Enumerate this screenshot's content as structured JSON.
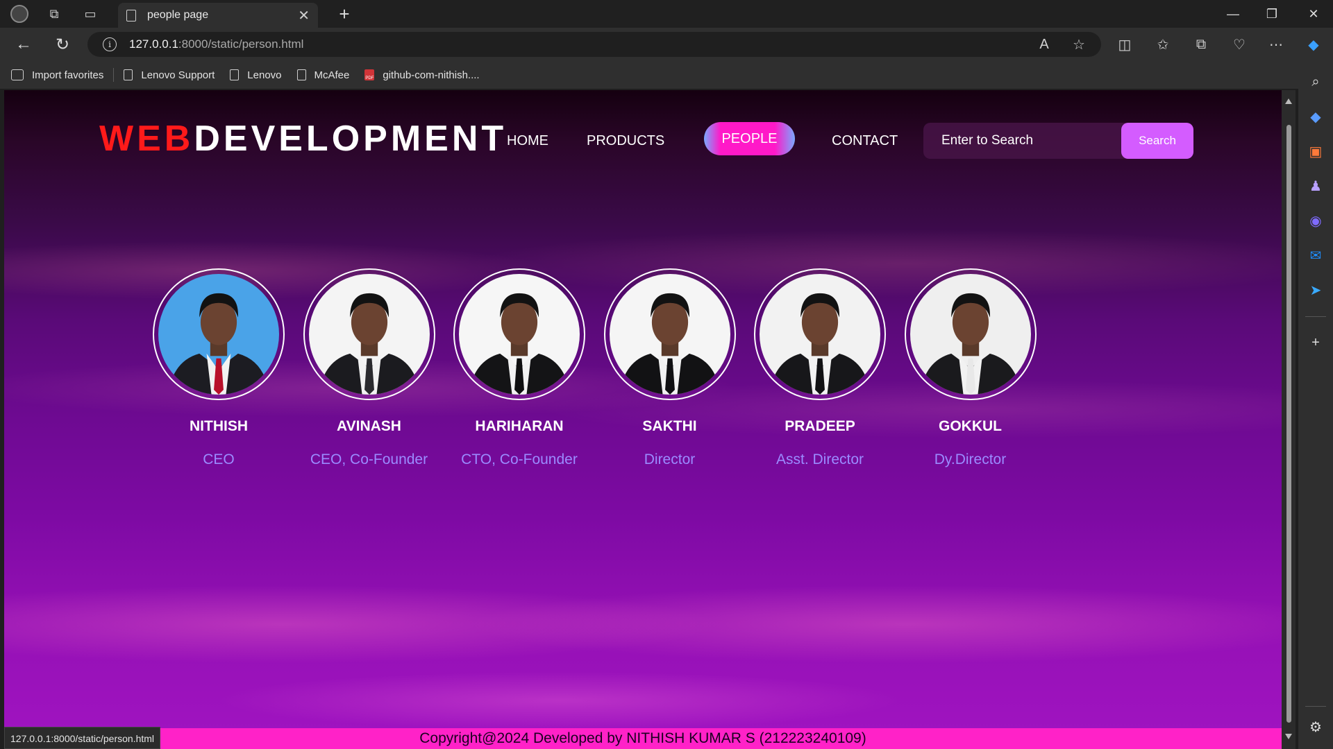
{
  "browser": {
    "tab_title": "people page",
    "url_host": "127.0.0.1",
    "url_rest": ":8000/static/person.html",
    "bookmarks": [
      {
        "label": "Import favorites",
        "icon": "import-icon"
      },
      {
        "label": "Lenovo Support",
        "icon": "page-icon"
      },
      {
        "label": "Lenovo",
        "icon": "page-icon"
      },
      {
        "label": "McAfee",
        "icon": "page-icon"
      },
      {
        "label": "github-com-nithish....",
        "icon": "pdf-icon"
      }
    ],
    "status_url": "127.0.0.1:8000/static/person.html"
  },
  "site": {
    "brand_web": "WEB",
    "brand_dev": "DEVELOPMENT",
    "nav": {
      "home": "HOME",
      "products": "PRODUCTS",
      "people": "PEOPLE",
      "contact": "CONTACT"
    },
    "search": {
      "placeholder": "Enter to Search",
      "button": "Search"
    },
    "people": [
      {
        "name": "NITHISH",
        "role": "CEO",
        "bg": "#4aa3e8",
        "suit": "#1c1c22",
        "tie": "#b8102a"
      },
      {
        "name": "AVINASH",
        "role": "CEO, Co-Founder",
        "bg": "#f4f4f4",
        "suit": "#1b1b1f",
        "tie": "#2a2a2e"
      },
      {
        "name": "HARIHARAN",
        "role": "CTO, Co-Founder",
        "bg": "#f6f6f6",
        "suit": "#141416",
        "tie": "#0f0f10"
      },
      {
        "name": "SAKTHI",
        "role": "Director",
        "bg": "#f5f5f5",
        "suit": "#121214",
        "tie": "#101012"
      },
      {
        "name": "PRADEEP",
        "role": "Asst. Director",
        "bg": "#f2f2f2",
        "suit": "#17171a",
        "tie": "#111113"
      },
      {
        "name": "GOKKUL",
        "role": "Dy.Director",
        "bg": "#efefef",
        "suit": "#1a1a1d",
        "tie": "#e8e8e8"
      }
    ],
    "footer": "Copyright@2024 Developed by NITHISH KUMAR S (212223240109)"
  },
  "colors": {
    "brand_web": "#ff1a1a",
    "pill": "#ff19c8",
    "search_button": "#d45cff",
    "role_text": "#9b8bff",
    "footer_bg": "#ff22c8"
  }
}
